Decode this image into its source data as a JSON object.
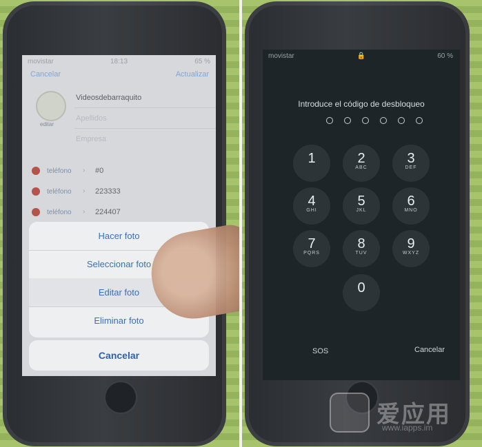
{
  "left": {
    "status": {
      "carrier": "movistar",
      "time": "18:13",
      "battery": "65 %"
    },
    "nav": {
      "cancel": "Cancelar",
      "update": "Actualizar"
    },
    "contact": {
      "edit_label": "editar",
      "name": "Videosdebarraquito",
      "surnames_placeholder": "Apellidos",
      "company_placeholder": "Empresa"
    },
    "phones": [
      {
        "label": "teléfono",
        "number": "#0"
      },
      {
        "label": "teléfono",
        "number": "223333"
      },
      {
        "label": "teléfono",
        "number": "224407"
      }
    ],
    "sheet_options": [
      "Hacer foto",
      "Seleccionar foto",
      "Editar foto",
      "Eliminar foto"
    ],
    "sheet_cancel": "Cancelar"
  },
  "right": {
    "status": {
      "carrier": "movistar",
      "battery": "60 %"
    },
    "title": "Introduce el código de desbloqueo",
    "keys": [
      {
        "digit": "1",
        "letters": ""
      },
      {
        "digit": "2",
        "letters": "ABC"
      },
      {
        "digit": "3",
        "letters": "DEF"
      },
      {
        "digit": "4",
        "letters": "GHI"
      },
      {
        "digit": "5",
        "letters": "JKL"
      },
      {
        "digit": "6",
        "letters": "MNO"
      },
      {
        "digit": "7",
        "letters": "PQRS"
      },
      {
        "digit": "8",
        "letters": "TUV"
      },
      {
        "digit": "9",
        "letters": "WXYZ"
      },
      {
        "digit": "0",
        "letters": ""
      }
    ],
    "sos": "SOS",
    "cancel": "Cancelar"
  },
  "watermark": {
    "brand": "爱应用",
    "url": "www.iapps.im"
  },
  "colors": {
    "ios_blue": "#3b6fb5",
    "lock_bg": "#1e2528",
    "sheet_bg": "#eeeff1"
  },
  "icons": [
    "signal-icon",
    "wifi-icon",
    "lock-icon",
    "battery-icon",
    "home-button-icon",
    "finger-image",
    "watermark-logo-icon"
  ]
}
